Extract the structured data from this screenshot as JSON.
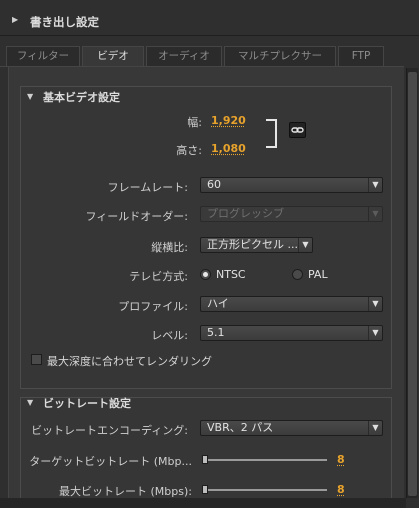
{
  "export_settings": {
    "title": "書き出し設定"
  },
  "tabs": [
    {
      "label": "フィルター",
      "active": false
    },
    {
      "label": "ビデオ",
      "active": true
    },
    {
      "label": "オーディオ",
      "active": false
    },
    {
      "label": "マルチプレクサー",
      "active": false
    },
    {
      "label": "FTP",
      "active": false
    }
  ],
  "basic_video": {
    "title": "基本ビデオ設定",
    "width_label": "幅:",
    "width_value": "1,920",
    "height_label": "高さ:",
    "height_value": "1,080",
    "frame_rate_label": "フレームレート:",
    "frame_rate_value": "60",
    "field_order_label": "フィールドオーダー:",
    "field_order_value": "プログレッシブ",
    "aspect_label": "縦横比:",
    "aspect_value": "正方形ピクセル ...",
    "tv_standard_label": "テレビ方式:",
    "tv_ntsc": "NTSC",
    "tv_pal": "PAL",
    "profile_label": "プロファイル:",
    "profile_value": "ハイ",
    "level_label": "レベル:",
    "level_value": "5.1",
    "max_depth_label": "最大深度に合わせてレンダリング"
  },
  "bitrate": {
    "title": "ビットレート設定",
    "encoding_label": "ビットレートエンコーディング:",
    "encoding_value": "VBR、2 パス",
    "target_label": "ターゲットビットレート (Mbp...",
    "target_value": "8",
    "max_label": "最大ビットレート (Mbps):",
    "max_value": "8"
  },
  "colors": {
    "accent_orange": "#e8a32c",
    "panel_bg": "#383838"
  }
}
